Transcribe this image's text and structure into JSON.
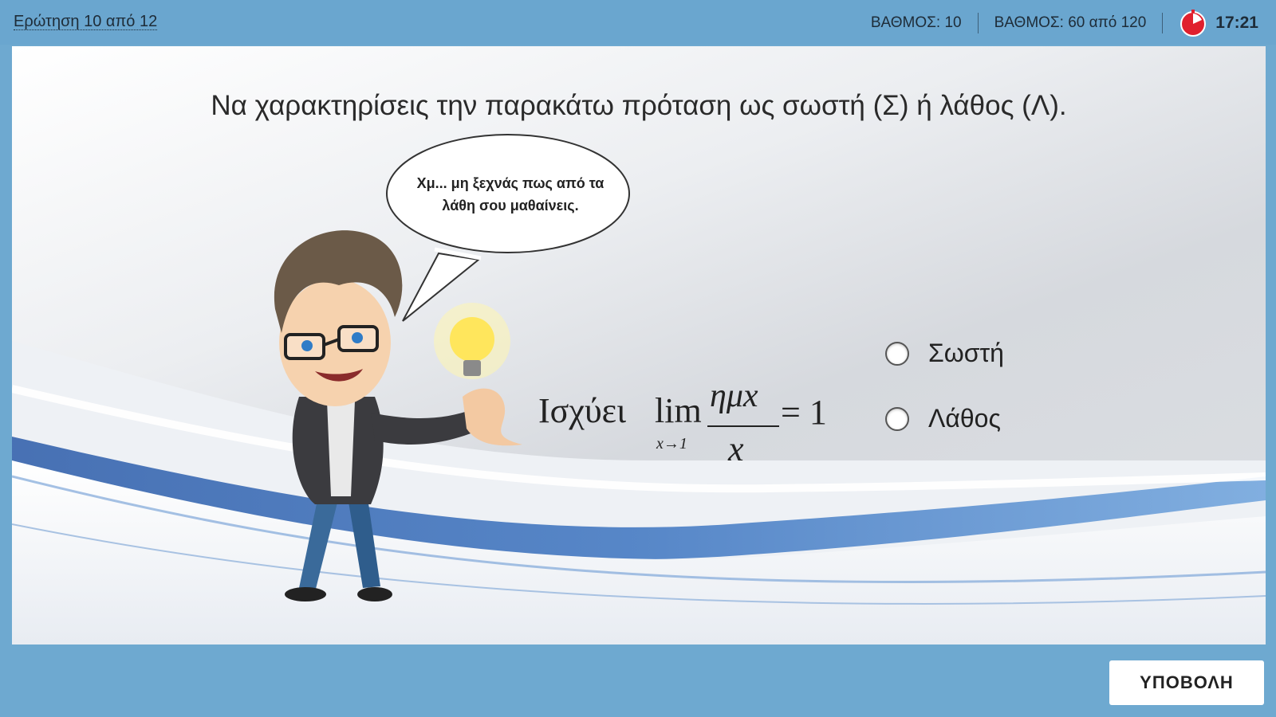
{
  "header": {
    "question_counter": "Ερώτηση 10 από 12",
    "score_label": "ΒΑΘΜΟΣ: 10",
    "total_score_label": "ΒΑΘΜΟΣ: 60 από 120",
    "timer_icon": "stopwatch-icon",
    "time": "17:21"
  },
  "question": {
    "prompt": "Να χαρακτηρίσεις την παρακάτω πρόταση ως σωστή (Σ) ή λάθος (Λ).",
    "speech_bubble": "Χμ... μη ξεχνάς πως από τα λάθη σου μαθαίνεις.",
    "formula": {
      "word": "Ισχύει",
      "lim": "lim",
      "subscript": "x→1",
      "numerator": "ημx",
      "denominator": "x",
      "result": "= 1"
    },
    "options": [
      {
        "label": "Σωστή",
        "selected": false
      },
      {
        "label": "Λάθος",
        "selected": false
      }
    ]
  },
  "footer": {
    "submit_label": "ΥΠΟΒΟΛΗ"
  },
  "colors": {
    "frame": "#6aa6cf",
    "timer": "#e0202e",
    "wave_blue": "#2f5fae"
  }
}
